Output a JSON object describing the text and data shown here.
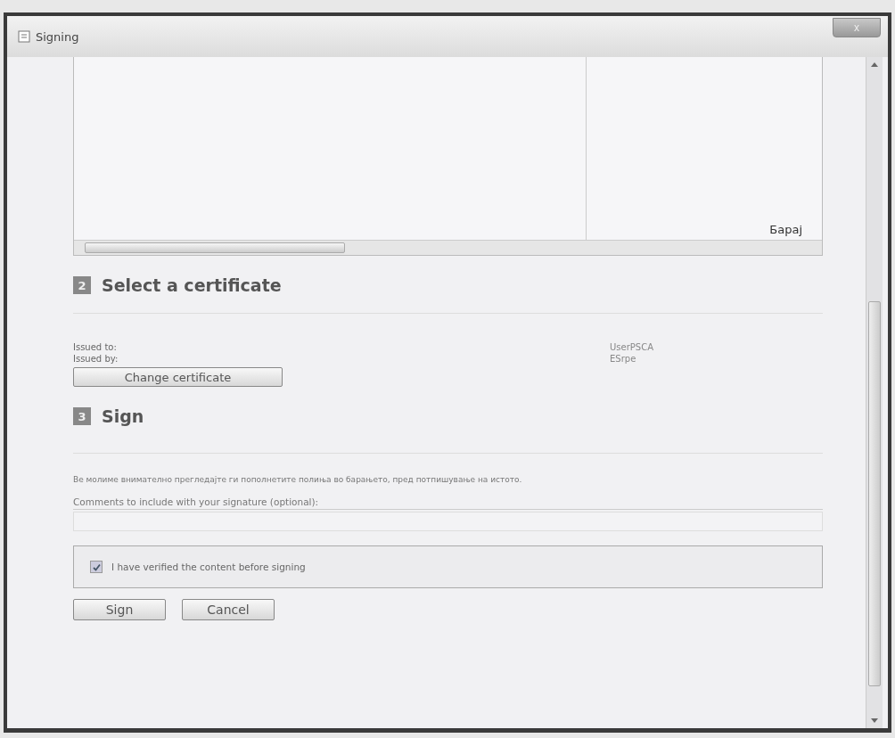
{
  "window": {
    "title": "Signing",
    "close_label": "x"
  },
  "preview": {
    "cut_text": "Барај"
  },
  "certificate_section": {
    "number": "2",
    "title": "Select a certificate",
    "fields": [
      {
        "label": "Issued to:",
        "value": "UserPSCA"
      },
      {
        "label": "Issued by:",
        "value": "ESrpe"
      }
    ],
    "change_button": "Change certificate"
  },
  "sign_section": {
    "number": "3",
    "title": "Sign",
    "notice": "Ве молиме внимателно прегледајте ги пополнетите полиња во барањето, пред потпишување на истото.",
    "comments_label": "Comments to include with your signature (optional):",
    "verify": {
      "label": "I have verified the content before signing",
      "checked": true
    },
    "buttons": [
      "Sign",
      "Cancel"
    ]
  }
}
